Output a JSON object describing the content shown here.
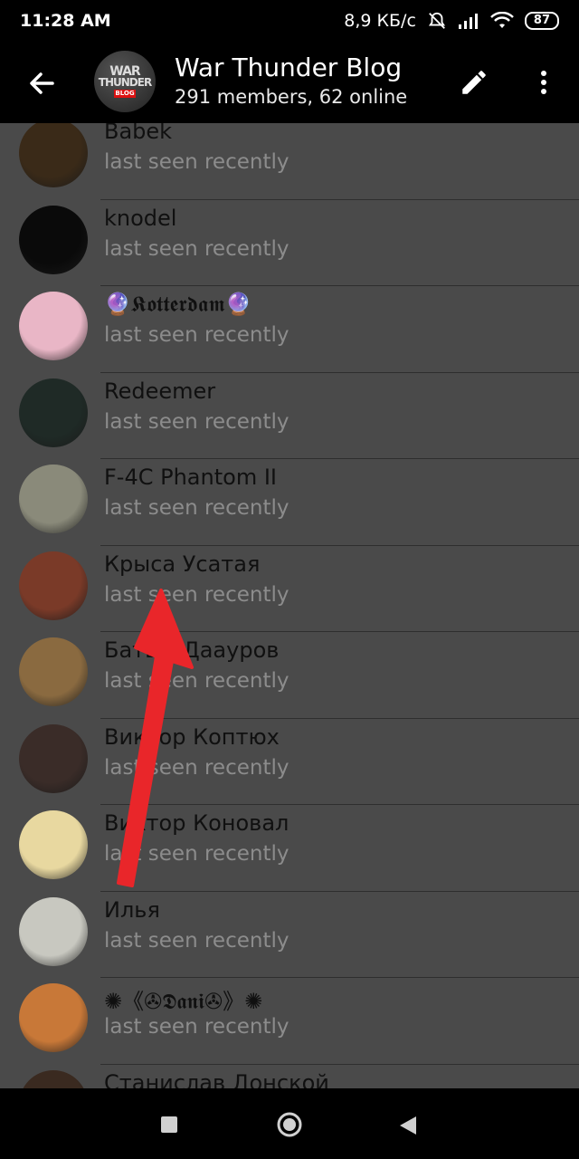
{
  "status_bar": {
    "time": "11:28 AM",
    "speed": "8,9 КБ/с",
    "battery": "87"
  },
  "header": {
    "avatar_lines": [
      "WAR",
      "THUNDER",
      "BLOG"
    ],
    "title": "War Thunder Blog",
    "subtitle": "291 members, 62 online"
  },
  "members": [
    {
      "name": "Babek",
      "status": "last seen recently",
      "avatar_color": "#3a2a18"
    },
    {
      "name": "knodel",
      "status": "last seen recently",
      "avatar_color": "#0a0a0a"
    },
    {
      "name": "🔮𝕶𝖔𝖙𝖙𝖊𝖗𝖉𝖆𝖒🔮",
      "status": "last seen recently",
      "avatar_color": "#e9b6c6"
    },
    {
      "name": "Redeemer",
      "status": "last seen recently",
      "avatar_color": "#1f2a26"
    },
    {
      "name": "F-4C Phantom II",
      "status": "last seen recently",
      "avatar_color": "#8a8a7a"
    },
    {
      "name": "Крыса Усатая",
      "status": "last seen recently",
      "avatar_color": "#7a3a28"
    },
    {
      "name": "Батыр Даауров",
      "status": "last seen recently",
      "avatar_color": "#8a6a40"
    },
    {
      "name": "Виктор Коптюх",
      "status": "last seen recently",
      "avatar_color": "#3a2c28"
    },
    {
      "name": "Виктор Коновал",
      "status": "last seen recently",
      "avatar_color": "#e8d8a0"
    },
    {
      "name": "Илья",
      "status": "last seen recently",
      "avatar_color": "#c8c8c0"
    },
    {
      "name": "✺《✇𝕯𝖆𝖓𝖎✇》✺",
      "status": "last seen recently",
      "avatar_color": "#c87838"
    },
    {
      "name": "Станислав Донской",
      "status": "",
      "avatar_color": "#3a2a20"
    }
  ]
}
